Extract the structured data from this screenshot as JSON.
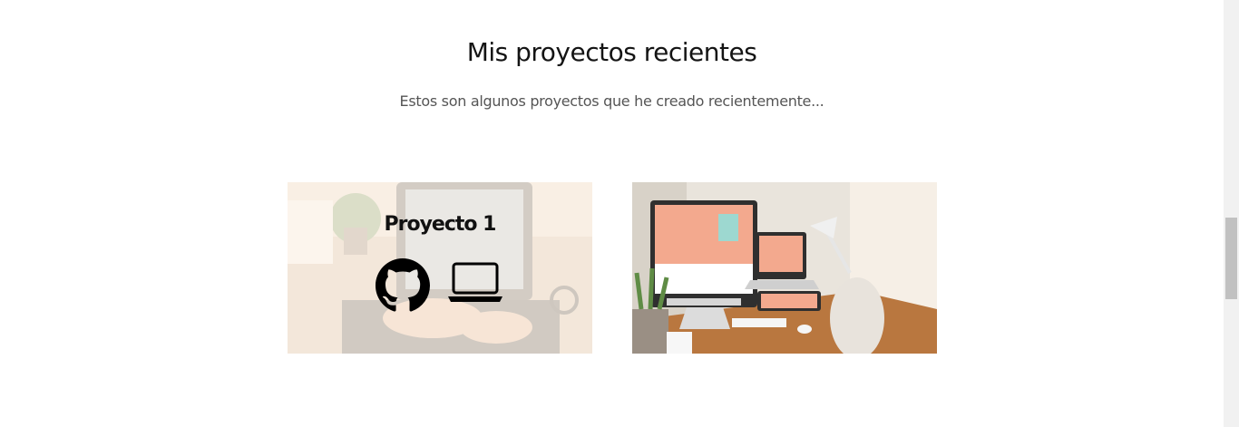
{
  "section": {
    "title": "Mis proyectos recientes",
    "subtitle": "Estos son algunos proyectos que he creado recientemente..."
  },
  "projects": [
    {
      "caption": "Proyecto 1",
      "links": [
        {
          "icon": "github-icon"
        },
        {
          "icon": "laptop-icon"
        }
      ],
      "overlay_color": "#fff6ec"
    },
    {
      "caption": "",
      "image": "responsive-devices-desk-photo"
    }
  ],
  "colors": {
    "title": "#141414",
    "subtitle": "#555555",
    "background": "#ffffff"
  }
}
